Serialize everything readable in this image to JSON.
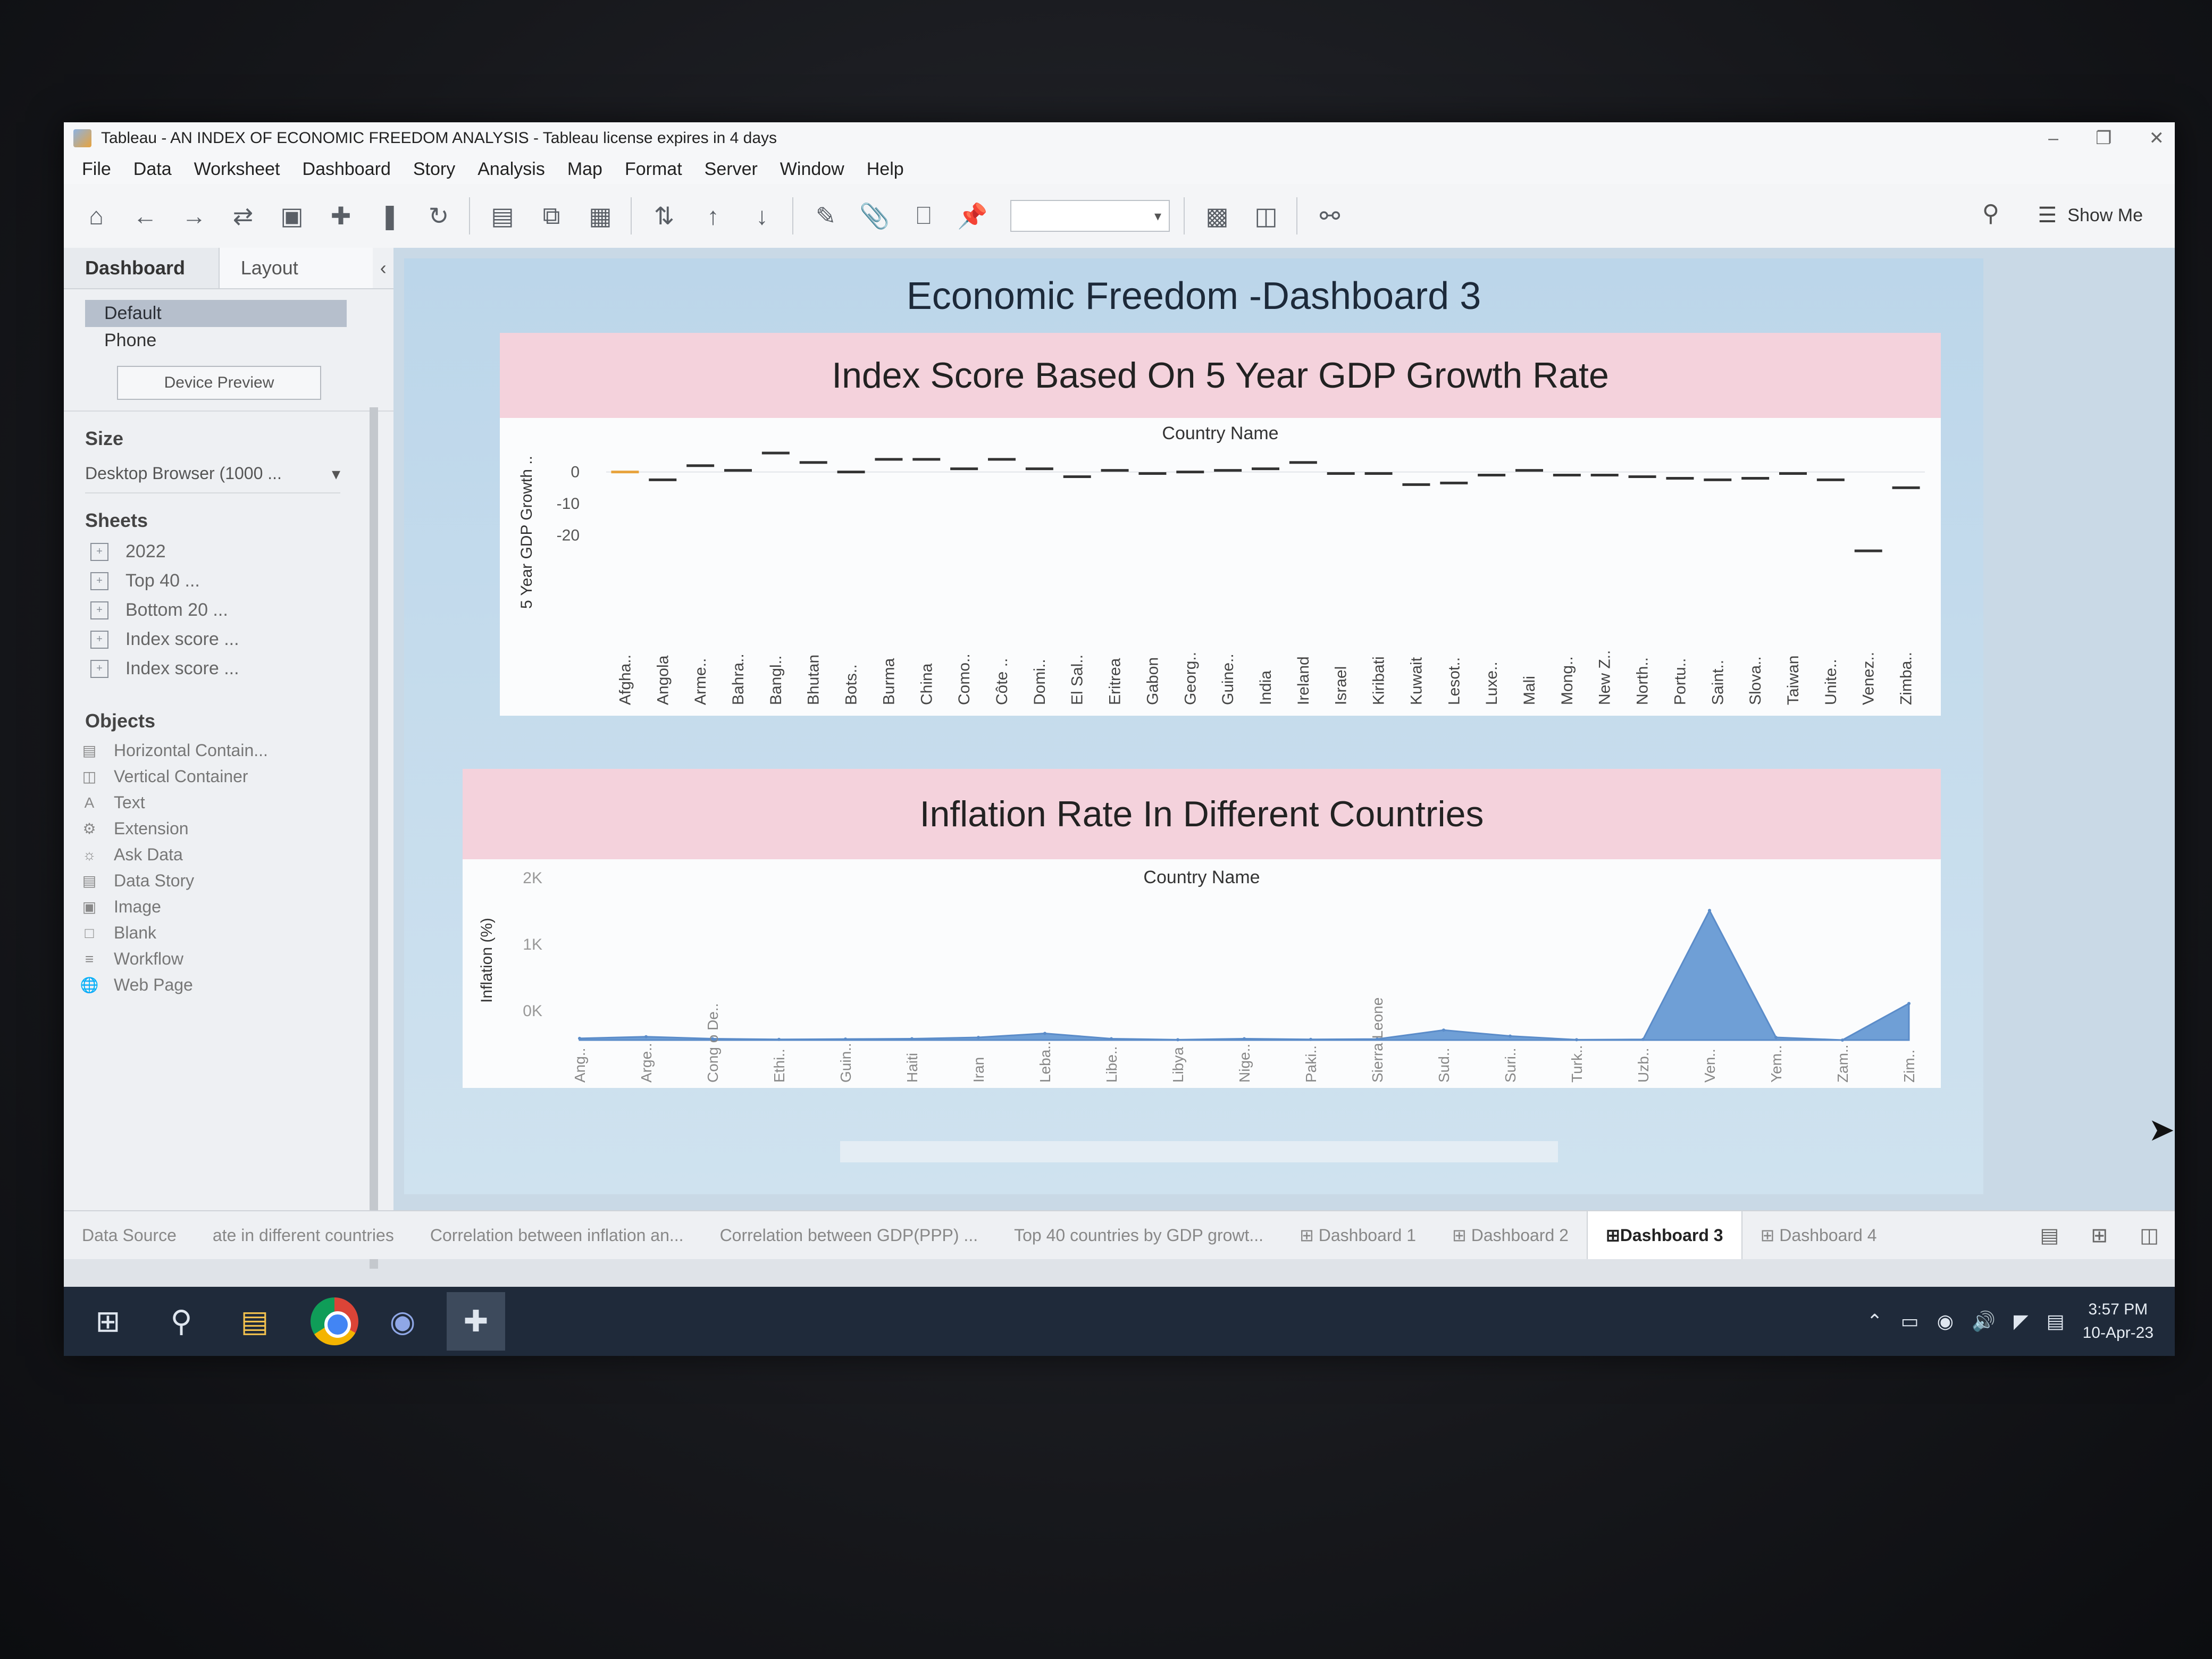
{
  "window": {
    "title": "Tableau - AN INDEX OF ECONOMIC FREEDOM ANALYSIS - Tableau license expires in 4 days"
  },
  "menu": [
    "File",
    "Data",
    "Worksheet",
    "Dashboard",
    "Story",
    "Analysis",
    "Map",
    "Format",
    "Server",
    "Window",
    "Help"
  ],
  "toolbar": {
    "show_me": "Show Me"
  },
  "left_panel": {
    "tabs": [
      "Dashboard",
      "Layout"
    ],
    "devices": [
      "Default",
      "Phone"
    ],
    "device_preview": "Device Preview",
    "size_heading": "Size",
    "size_value": "Desktop Browser (1000 ...",
    "sheets_heading": "Sheets",
    "sheets": [
      "2022",
      "Top 40 ...",
      "Bottom 20 ...",
      "Index score ...",
      "Index score ..."
    ],
    "objects_heading": "Objects",
    "objects": [
      "Horizontal Contain...",
      "Vertical Container",
      "Text",
      "Extension",
      "Ask Data",
      "Data Story",
      "Image",
      "Blank",
      "Workflow",
      "Web Page"
    ]
  },
  "dashboard": {
    "title": "Economic Freedom -Dashboard 3",
    "panel1_title": "Index Score Based On 5 Year GDP Growth Rate",
    "panel2_title": "Inflation Rate In Different Countries"
  },
  "chart_data": [
    {
      "type": "scatter",
      "mark": "dash",
      "title": "Country Name",
      "xlabel": "",
      "ylabel": "5 Year GDP Growth ..",
      "y_ticks": [
        "0",
        "-10",
        "-20"
      ],
      "ylim": [
        -25,
        7
      ],
      "categories": [
        "Afgha..",
        "Angola",
        "Arme..",
        "Bahra..",
        "Bangl..",
        "Bhutan",
        "Bots..",
        "Burma",
        "China",
        "Como..",
        "Côte ..",
        "Domi..",
        "El Sal..",
        "Eritrea",
        "Gabon",
        "Georg..",
        "Guine..",
        "India",
        "Ireland",
        "Israel",
        "Kiribati",
        "Kuwait",
        "Lesot..",
        "Luxe..",
        "Mali",
        "Mong..",
        "New Z..",
        "North..",
        "Portu..",
        "Saint..",
        "Slova..",
        "Taiwan",
        "Unite..",
        "Venez..",
        "Zimba.."
      ],
      "values": [
        0,
        -2.5,
        2,
        0.5,
        6,
        3,
        0,
        4,
        4,
        1,
        4,
        1,
        -1.5,
        0.5,
        -0.5,
        0,
        0.5,
        1,
        3,
        -0.5,
        -0.5,
        -4,
        -3.5,
        -1,
        0.5,
        -1,
        -1,
        -1.5,
        -2,
        -2.5,
        -2,
        -0.5,
        -2.5,
        -25,
        -5
      ]
    },
    {
      "type": "area",
      "title": "Country Name",
      "xlabel": "",
      "ylabel": "Inflation (%)",
      "y_ticks": [
        "2K",
        "1K",
        "0K"
      ],
      "ylim": [
        0,
        2000
      ],
      "categories": [
        "Ang..",
        "Arge..",
        "Cong o De..",
        "Ethi..",
        "Guin..",
        "Haiti",
        "Iran",
        "Leba..",
        "Libe..",
        "Libya",
        "Nige..",
        "Paki..",
        "Sierra Leone",
        "Sud..",
        "Suri..",
        "Turk..",
        "Uzb..",
        "Ven..",
        "Yem..",
        "Zam..",
        "Zim.."
      ],
      "values": [
        25,
        50,
        20,
        10,
        15,
        20,
        40,
        100,
        20,
        5,
        20,
        10,
        15,
        150,
        60,
        5,
        10,
        1950,
        40,
        0,
        550
      ]
    }
  ],
  "sheet_tabs": [
    "Data Source",
    "ate in different countries",
    "Correlation between inflation an...",
    "Correlation between GDP(PPP) ...",
    "Top 40 countries by GDP growt...",
    "Dashboard 1",
    "Dashboard 2",
    "Dashboard 3",
    "Dashboard 4"
  ],
  "active_sheet_tab": "Dashboard 3",
  "taskbar": {
    "time": "3:57 PM",
    "date": "10-Apr-23"
  }
}
